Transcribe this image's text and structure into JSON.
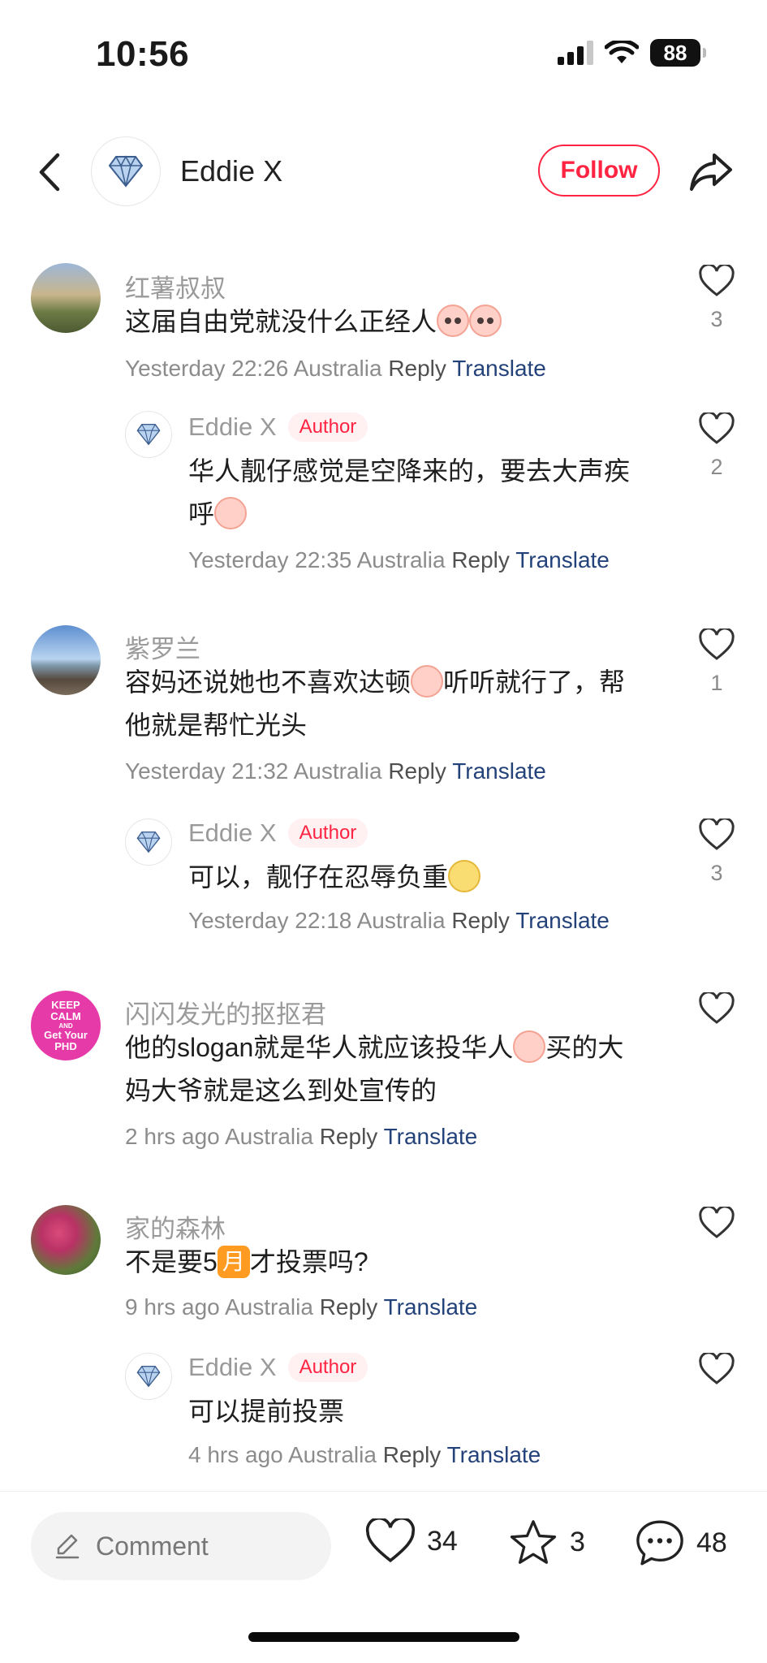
{
  "status_bar": {
    "time": "10:56",
    "battery": "88"
  },
  "header": {
    "name": "Eddie X",
    "follow_label": "Follow"
  },
  "comments": [
    {
      "user": "红薯叔叔",
      "text": "这届自由党就没什么正经人",
      "time": "Yesterday 22:26",
      "location": "Australia",
      "reply_label": "Reply",
      "translate_label": "Translate",
      "likes": "3"
    },
    {
      "user": "Eddie X",
      "badge": "Author",
      "text_line1": "华人靓仔感觉是空降来的，要去大声疾",
      "text_line2": "呼",
      "time": "Yesterday 22:35",
      "location": "Australia",
      "reply_label": "Reply",
      "translate_label": "Translate",
      "likes": "2"
    },
    {
      "user": "紫罗兰",
      "text_line1a": "容妈还说她也不喜欢达顿",
      "text_line1b": "听听就行了，帮",
      "text_line2": "他就是帮忙光头",
      "time": "Yesterday 21:32",
      "location": "Australia",
      "reply_label": "Reply",
      "translate_label": "Translate",
      "likes": "1"
    },
    {
      "user": "Eddie X",
      "badge": "Author",
      "text": "可以，靓仔在忍辱负重",
      "time": "Yesterday 22:18",
      "location": "Australia",
      "reply_label": "Reply",
      "translate_label": "Translate",
      "likes": "3"
    },
    {
      "user": "闪闪发光的抠抠君",
      "avatar_text": [
        "KEEP",
        "CALM",
        "AND",
        "Get Your",
        "PHD"
      ],
      "text_line1a": "他的slogan就是华人就应该投华人",
      "text_line1b": "买的大",
      "text_line2": "妈大爷就是这么到处宣传的",
      "time": "2 hrs ago",
      "location": "Australia",
      "reply_label": "Reply",
      "translate_label": "Translate"
    },
    {
      "user": "家的森林",
      "text_a": "不是要5",
      "month": "月",
      "text_b": "才投票吗?",
      "time": "9 hrs ago",
      "location": "Australia",
      "reply_label": "Reply",
      "translate_label": "Translate"
    },
    {
      "user": "Eddie X",
      "badge": "Author",
      "text": "可以提前投票",
      "time": "4 hrs ago",
      "location": "Australia",
      "reply_label": "Reply",
      "translate_label": "Translate"
    }
  ],
  "bottom_bar": {
    "comment_placeholder": "Comment",
    "likes": "34",
    "stars": "3",
    "comments": "48"
  },
  "colors": {
    "accent": "#ff2442",
    "translate": "#24427a",
    "muted": "#8c8c8c"
  }
}
